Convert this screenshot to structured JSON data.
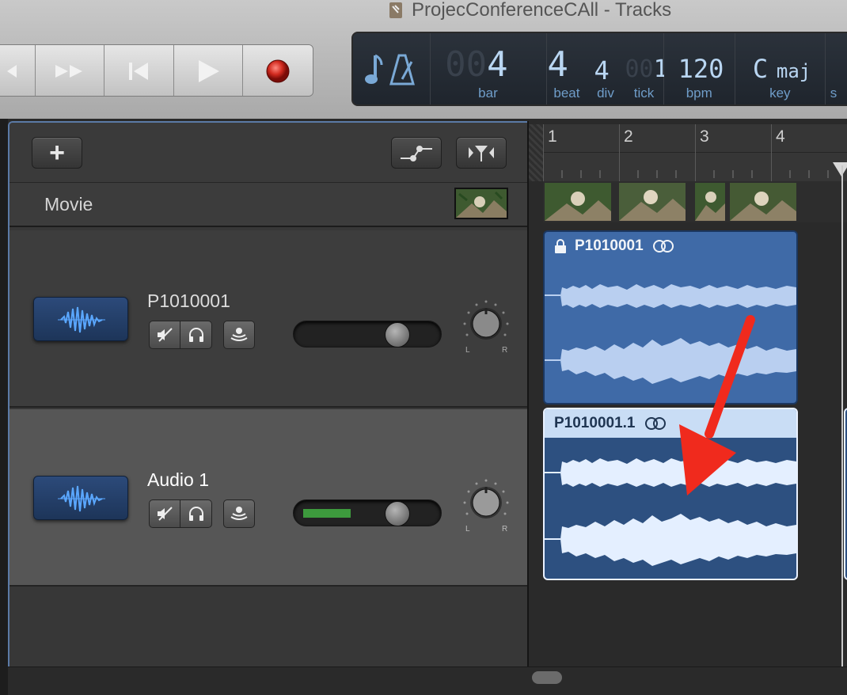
{
  "window": {
    "title": "ProjecConferenceCAll - Tracks",
    "doc_icon": "garageband-document-icon"
  },
  "transport": {
    "buttons": [
      "rewind",
      "fast-forward",
      "go-to-beginning",
      "play",
      "record"
    ],
    "record_color": "#d12a1f"
  },
  "lcd": {
    "bar_dim": "00",
    "bar": "4",
    "bar_label": "bar",
    "beat": "4",
    "beat_label": "beat",
    "div": "4",
    "div_label": "div",
    "tick_dim": "00",
    "tick": "1",
    "tick_label": "tick",
    "bpm": "120",
    "bpm_label": "bpm",
    "key_letter": "C",
    "key_mode": "maj",
    "key_label": "key",
    "cut_label": "s"
  },
  "tracks_header": {
    "add_button": "+",
    "movie_label": "Movie"
  },
  "tracks": [
    {
      "name": "P1010001",
      "pan_left": "L",
      "pan_right": "R",
      "fader_level": 0.7,
      "meter_level": 0
    },
    {
      "name": "Audio 1",
      "pan_left": "L",
      "pan_right": "R",
      "fader_level": 0.7,
      "meter_level": 0.33
    }
  ],
  "ruler": {
    "bars": [
      "1",
      "2",
      "3",
      "4"
    ]
  },
  "regions": [
    {
      "name": "P1010001",
      "locked": true,
      "selected": false
    },
    {
      "name": "P1010001.1",
      "locked": false,
      "selected": true
    }
  ],
  "colors": {
    "region_blue": "#3f6aa7",
    "selected_region_header": "#c9ddf5",
    "annotation_arrow": "#f02a1d",
    "meter_green": "#3d9a3d"
  }
}
